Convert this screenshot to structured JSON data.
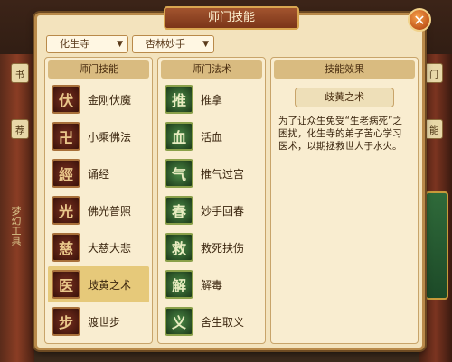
{
  "panel": {
    "title": "师门技能",
    "close_symbol": "✕"
  },
  "filters": {
    "school": "化生寺",
    "sub_school": "杏林妙手"
  },
  "columns": {
    "skills_header": "师门技能",
    "arts_header": "师门法术",
    "effect_header": "技能效果"
  },
  "skills": [
    {
      "label": "金刚伏魔",
      "glyph": "伏",
      "icon": "vajra-icon"
    },
    {
      "label": "小乘佛法",
      "glyph": "卍",
      "icon": "dharma-icon"
    },
    {
      "label": "诵经",
      "glyph": "經",
      "icon": "scripture-icon"
    },
    {
      "label": "佛光普照",
      "glyph": "光",
      "icon": "buddha-light-icon"
    },
    {
      "label": "大慈大悲",
      "glyph": "慈",
      "icon": "compassion-icon"
    },
    {
      "label": "歧黄之术",
      "glyph": "医",
      "icon": "medicine-icon"
    },
    {
      "label": "渡世步",
      "glyph": "步",
      "icon": "step-icon"
    }
  ],
  "arts": [
    {
      "label": "推拿",
      "glyph": "推",
      "icon": "massage-icon"
    },
    {
      "label": "活血",
      "glyph": "血",
      "icon": "blood-icon"
    },
    {
      "label": "推气过宫",
      "glyph": "气",
      "icon": "qi-icon"
    },
    {
      "label": "妙手回春",
      "glyph": "春",
      "icon": "rejuvenate-icon"
    },
    {
      "label": "救死扶伤",
      "glyph": "救",
      "icon": "rescue-icon"
    },
    {
      "label": "解毒",
      "glyph": "解",
      "icon": "detox-icon"
    },
    {
      "label": "舍生取义",
      "glyph": "义",
      "icon": "sacrifice-icon"
    }
  ],
  "selected_skill_index": 5,
  "effect": {
    "name": "歧黄之术",
    "description": "为了让众生免受“生老病死”之困扰，化生寺的弟子苦心学习医术，以期拯救世人于水火。"
  },
  "scene": {
    "side_tags": [
      "书",
      "荐",
      "门",
      "能"
    ],
    "vertical_text": "梦幻工具"
  }
}
